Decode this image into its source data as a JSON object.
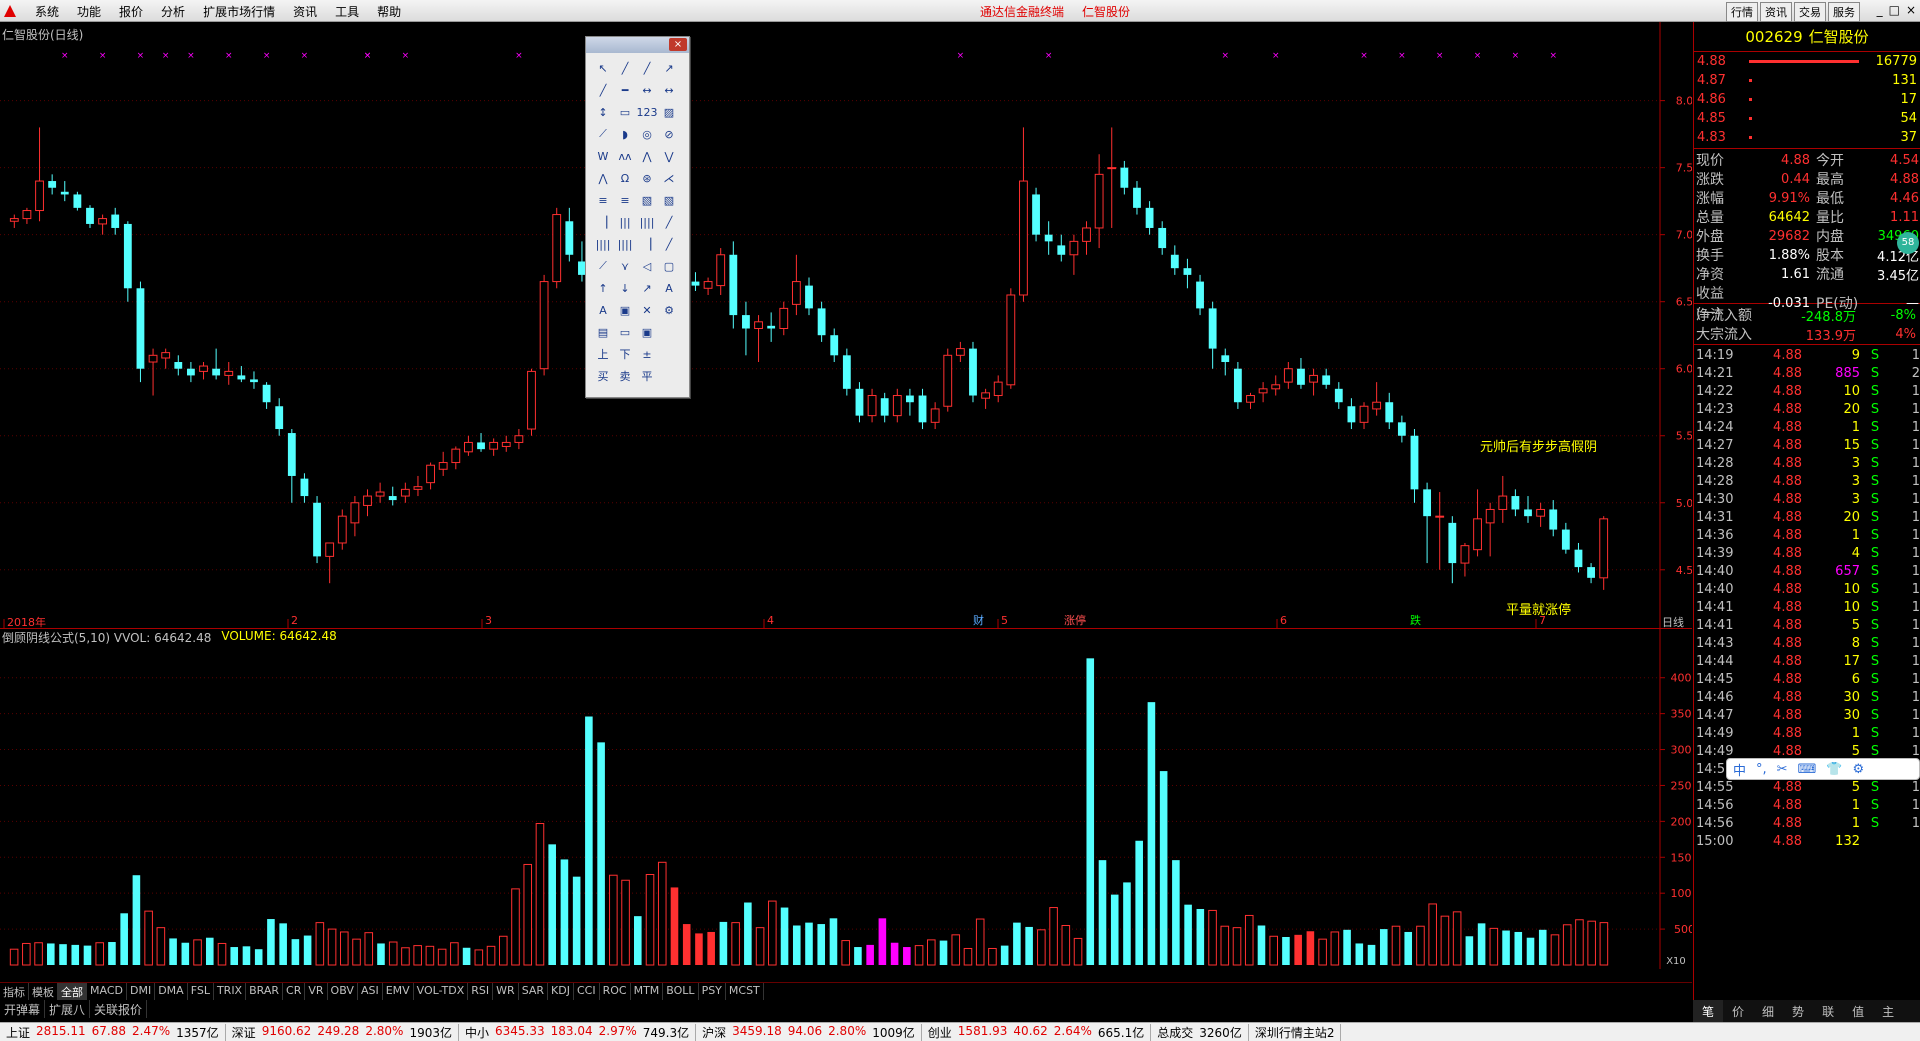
{
  "menubar": {
    "items": [
      "系统",
      "功能",
      "报价",
      "分析",
      "扩展市场行情",
      "资讯",
      "工具",
      "帮助"
    ],
    "center_title": "通达信金融终端",
    "center_stock": "仁智股份",
    "right_buttons": [
      "行情",
      "资讯",
      "交易",
      "服务"
    ],
    "win_controls": [
      "_",
      "□",
      "×"
    ]
  },
  "main_chart": {
    "title": "仁智股份(日线)",
    "annotation_1": "元帅后有步步高假阴",
    "annotation_2": "平量就涨停",
    "markers": [
      {
        "text": "财",
        "color": "#5aaaff"
      },
      {
        "text": "涨停",
        "color": "#ff5050"
      },
      {
        "text": "跌",
        "color": "#00ff00"
      }
    ],
    "y_ticks": [
      "8.00",
      "7.50",
      "7.00",
      "6.50",
      "6.00",
      "5.50",
      "5.00",
      "4.50"
    ],
    "x_labels": [
      "2018年",
      "2",
      "3",
      "4",
      "5",
      "6",
      "7"
    ],
    "period_label": "日线"
  },
  "vol_chart": {
    "title": "倒顾阴线公式(5,10)  VVOL: 64642.48",
    "volume_label": "VOLUME: 64642.48",
    "y_ticks": [
      "40000",
      "35000",
      "30000",
      "25000",
      "20000",
      "15000",
      "10000",
      "5000"
    ],
    "scale_label": "X10"
  },
  "chart_data": {
    "type": "candlestick",
    "ylim": [
      4.2,
      8.4
    ],
    "candles": [
      [
        7.1,
        7.15,
        7.05,
        7.12
      ],
      [
        7.12,
        7.2,
        7.08,
        7.18
      ],
      [
        7.18,
        7.8,
        7.1,
        7.4
      ],
      [
        7.4,
        7.45,
        7.3,
        7.35
      ],
      [
        7.32,
        7.4,
        7.25,
        7.3
      ],
      [
        7.3,
        7.32,
        7.18,
        7.2
      ],
      [
        7.2,
        7.22,
        7.05,
        7.08
      ],
      [
        7.08,
        7.15,
        7.0,
        7.12
      ],
      [
        7.15,
        7.2,
        7.0,
        7.05
      ],
      [
        7.08,
        7.1,
        6.5,
        6.6
      ],
      [
        6.6,
        6.65,
        5.9,
        6.0
      ],
      [
        6.05,
        6.15,
        5.8,
        6.1
      ],
      [
        6.08,
        6.15,
        6.0,
        6.12
      ],
      [
        6.05,
        6.1,
        5.95,
        6.0
      ],
      [
        6.0,
        6.05,
        5.9,
        5.95
      ],
      [
        5.98,
        6.05,
        5.92,
        6.02
      ],
      [
        6.0,
        6.15,
        5.92,
        5.95
      ],
      [
        5.95,
        6.05,
        5.88,
        5.98
      ],
      [
        5.95,
        6.02,
        5.9,
        5.92
      ],
      [
        5.92,
        5.98,
        5.85,
        5.9
      ],
      [
        5.88,
        5.9,
        5.7,
        5.75
      ],
      [
        5.72,
        5.78,
        5.5,
        5.55
      ],
      [
        5.52,
        5.55,
        5.0,
        5.2
      ],
      [
        5.18,
        5.22,
        5.0,
        5.05
      ],
      [
        5.0,
        5.05,
        4.55,
        4.6
      ],
      [
        4.6,
        4.7,
        4.4,
        4.7
      ],
      [
        4.7,
        4.95,
        4.65,
        4.9
      ],
      [
        4.85,
        5.05,
        4.75,
        5.0
      ],
      [
        4.98,
        5.1,
        4.9,
        5.05
      ],
      [
        5.05,
        5.15,
        5.0,
        5.08
      ],
      [
        5.05,
        5.12,
        4.98,
        5.02
      ],
      [
        5.05,
        5.15,
        5.0,
        5.1
      ],
      [
        5.1,
        5.2,
        5.05,
        5.12
      ],
      [
        5.15,
        5.3,
        5.1,
        5.28
      ],
      [
        5.25,
        5.38,
        5.2,
        5.3
      ],
      [
        5.3,
        5.42,
        5.25,
        5.4
      ],
      [
        5.38,
        5.5,
        5.35,
        5.45
      ],
      [
        5.45,
        5.52,
        5.38,
        5.4
      ],
      [
        5.4,
        5.48,
        5.35,
        5.45
      ],
      [
        5.42,
        5.5,
        5.38,
        5.45
      ],
      [
        5.45,
        5.55,
        5.4,
        5.5
      ],
      [
        5.55,
        6.0,
        5.5,
        5.98
      ],
      [
        6.0,
        6.7,
        5.95,
        6.65
      ],
      [
        6.65,
        7.2,
        6.6,
        7.15
      ],
      [
        7.1,
        7.2,
        6.8,
        6.85
      ],
      [
        6.8,
        6.95,
        6.65,
        6.7
      ],
      [
        6.72,
        6.8,
        6.55,
        6.6
      ],
      [
        6.58,
        6.65,
        6.5,
        6.55
      ],
      [
        6.55,
        6.62,
        6.45,
        6.5
      ],
      [
        6.5,
        6.6,
        6.45,
        6.52
      ],
      [
        6.52,
        6.7,
        6.48,
        6.65
      ],
      [
        6.62,
        6.7,
        6.55,
        6.58
      ],
      [
        6.58,
        6.65,
        6.52,
        6.6
      ],
      [
        6.62,
        6.7,
        6.55,
        6.65
      ],
      [
        6.65,
        6.72,
        6.58,
        6.62
      ],
      [
        6.6,
        6.68,
        6.55,
        6.65
      ],
      [
        6.62,
        6.9,
        6.55,
        6.85
      ],
      [
        6.85,
        6.95,
        6.3,
        6.4
      ],
      [
        6.4,
        6.5,
        6.1,
        6.3
      ],
      [
        6.3,
        6.4,
        6.05,
        6.35
      ],
      [
        6.32,
        6.42,
        6.2,
        6.3
      ],
      [
        6.3,
        6.5,
        6.25,
        6.45
      ],
      [
        6.48,
        6.85,
        6.4,
        6.65
      ],
      [
        6.62,
        6.68,
        6.4,
        6.45
      ],
      [
        6.45,
        6.5,
        6.2,
        6.25
      ],
      [
        6.25,
        6.3,
        6.05,
        6.1
      ],
      [
        6.1,
        6.15,
        5.8,
        5.85
      ],
      [
        5.85,
        5.9,
        5.6,
        5.65
      ],
      [
        5.65,
        5.85,
        5.6,
        5.8
      ],
      [
        5.78,
        5.82,
        5.6,
        5.65
      ],
      [
        5.65,
        5.85,
        5.6,
        5.8
      ],
      [
        5.8,
        5.85,
        5.65,
        5.75
      ],
      [
        5.8,
        5.85,
        5.55,
        5.6
      ],
      [
        5.6,
        5.75,
        5.55,
        5.7
      ],
      [
        5.72,
        6.15,
        5.68,
        6.1
      ],
      [
        6.1,
        6.2,
        6.05,
        6.15
      ],
      [
        6.15,
        6.2,
        5.75,
        5.8
      ],
      [
        5.78,
        5.85,
        5.7,
        5.82
      ],
      [
        5.8,
        5.95,
        5.75,
        5.9
      ],
      [
        5.88,
        6.6,
        5.85,
        6.55
      ],
      [
        6.55,
        7.8,
        6.5,
        7.4
      ],
      [
        7.3,
        7.35,
        6.95,
        7.0
      ],
      [
        7.0,
        7.1,
        6.85,
        6.95
      ],
      [
        6.92,
        7.0,
        6.8,
        6.85
      ],
      [
        6.85,
        7.0,
        6.7,
        6.95
      ],
      [
        6.95,
        7.1,
        6.85,
        7.05
      ],
      [
        7.05,
        7.6,
        6.9,
        7.45
      ],
      [
        7.5,
        7.8,
        7.05,
        7.5
      ],
      [
        7.5,
        7.55,
        7.3,
        7.35
      ],
      [
        7.35,
        7.4,
        7.15,
        7.2
      ],
      [
        7.2,
        7.25,
        7.0,
        7.05
      ],
      [
        7.05,
        7.1,
        6.85,
        6.9
      ],
      [
        6.85,
        6.92,
        6.7,
        6.75
      ],
      [
        6.75,
        6.82,
        6.6,
        6.7
      ],
      [
        6.65,
        6.7,
        6.4,
        6.45
      ],
      [
        6.45,
        6.5,
        6.0,
        6.15
      ],
      [
        6.1,
        6.15,
        5.95,
        6.05
      ],
      [
        6.0,
        6.05,
        5.7,
        5.75
      ],
      [
        5.75,
        5.82,
        5.7,
        5.8
      ],
      [
        5.82,
        5.9,
        5.75,
        5.85
      ],
      [
        5.85,
        5.95,
        5.8,
        5.88
      ],
      [
        5.9,
        6.05,
        5.85,
        6.0
      ],
      [
        6.0,
        6.08,
        5.85,
        5.88
      ],
      [
        5.9,
        6.0,
        5.8,
        5.95
      ],
      [
        5.95,
        6.0,
        5.85,
        5.88
      ],
      [
        5.85,
        5.9,
        5.7,
        5.75
      ],
      [
        5.72,
        5.78,
        5.55,
        5.6
      ],
      [
        5.6,
        5.75,
        5.55,
        5.72
      ],
      [
        5.7,
        5.9,
        5.65,
        5.75
      ],
      [
        5.75,
        5.82,
        5.55,
        5.6
      ],
      [
        5.6,
        5.65,
        5.45,
        5.5
      ],
      [
        5.5,
        5.55,
        5.0,
        5.1
      ],
      [
        5.1,
        5.15,
        4.55,
        4.9
      ],
      [
        4.9,
        5.08,
        4.5,
        4.9
      ],
      [
        4.85,
        4.9,
        4.4,
        4.55
      ],
      [
        4.55,
        4.7,
        4.45,
        4.68
      ],
      [
        4.65,
        5.1,
        4.6,
        4.88
      ],
      [
        4.85,
        5.0,
        4.6,
        4.95
      ],
      [
        4.95,
        5.2,
        4.85,
        5.05
      ],
      [
        5.05,
        5.1,
        4.9,
        4.95
      ],
      [
        4.95,
        5.05,
        4.85,
        4.9
      ],
      [
        4.9,
        5.0,
        4.82,
        4.95
      ],
      [
        4.95,
        5.02,
        4.75,
        4.8
      ],
      [
        4.8,
        4.85,
        4.62,
        4.65
      ],
      [
        4.65,
        4.7,
        4.48,
        4.52
      ],
      [
        4.52,
        4.55,
        4.4,
        4.44
      ],
      [
        4.44,
        4.9,
        4.35,
        4.88
      ]
    ],
    "volumes": [
      2200,
      3000,
      3100,
      3000,
      2900,
      2800,
      2700,
      3100,
      3200,
      7200,
      12500,
      7500,
      5200,
      3700,
      3100,
      3500,
      3800,
      3000,
      2500,
      2600,
      2200,
      6400,
      5800,
      3600,
      4100,
      5900,
      5000,
      4600,
      3600,
      4500,
      3000,
      3200,
      2400,
      2700,
      2600,
      2200,
      3100,
      2400,
      2100,
      2600,
      4000,
      10600,
      14000,
      19700,
      16800,
      14700,
      12300,
      34600,
      31000,
      12500,
      11800,
      6800,
      12600,
      14300,
      10800,
      5700,
      4400,
      4600,
      6000,
      5900,
      8700,
      5200,
      8900,
      8000,
      5500,
      5900,
      5700,
      6500,
      3400,
      2500,
      2800,
      6500,
      3100,
      2500,
      2700,
      3500,
      3400,
      4200,
      2300,
      6400,
      2300,
      2700,
      5900,
      5300,
      4900,
      8000,
      5500,
      3700,
      42700,
      14600,
      9800,
      11500,
      17300,
      36600,
      27000,
      14600,
      8400,
      7800,
      7600,
      5400,
      5200,
      6900,
      5500,
      4000,
      3900,
      4200,
      4700,
      3600,
      4600,
      4900,
      3000,
      2800,
      5000,
      5400,
      4600,
      5400,
      8500,
      6800,
      7400,
      4000,
      5800,
      5100,
      4800,
      4600,
      3800,
      4900,
      4200,
      5600,
      6300,
      6100,
      5900
    ],
    "volume_colors": {
      "up": "#ff3030",
      "down": "#54ffff",
      "special": "#ff00ff"
    }
  },
  "toolbox": {
    "close": "×",
    "tools": [
      "↖",
      "╱",
      "╱",
      "↗",
      "╱",
      "━",
      "↔",
      "↔",
      "↕",
      "▭",
      "123",
      "▨",
      "⟋",
      "◗",
      "◎",
      "⊘",
      "W",
      "ʌʌ",
      "⋀",
      "⋁",
      "⋀",
      "Ω",
      "⊛",
      "⋌",
      "≡",
      "≡",
      "▧",
      "▧",
      "▕",
      "|||",
      "||||",
      "╱",
      "||||",
      "||||",
      "▕",
      "╱",
      "⟋",
      "⋎",
      "◁",
      "▢",
      "↑",
      "↓",
      "↗",
      "A",
      "A",
      "▣",
      "✕",
      "⚙",
      "▤",
      "▭",
      "▣",
      " ",
      "上",
      "下",
      "±",
      " ",
      "买",
      "卖",
      "平"
    ]
  },
  "right_panel": {
    "stock_code": "002629",
    "stock_name": "仁智股份",
    "orders": [
      {
        "price": "4.88",
        "bar": 1.0,
        "qty": "16779"
      },
      {
        "price": "4.87",
        "bar": 0.02,
        "qty": "131"
      },
      {
        "price": "4.86",
        "bar": 0.02,
        "qty": "17"
      },
      {
        "price": "4.85",
        "bar": 0.02,
        "qty": "54"
      },
      {
        "price": "4.83",
        "bar": 0.02,
        "qty": "37"
      }
    ],
    "badge": "58",
    "quotes": [
      {
        "k1": "现价",
        "v1": "4.88",
        "c1": "red",
        "k2": "今开",
        "v2": "4.54",
        "c2": "red"
      },
      {
        "k1": "涨跌",
        "v1": "0.44",
        "c1": "red",
        "k2": "最高",
        "v2": "4.88",
        "c2": "red"
      },
      {
        "k1": "涨幅",
        "v1": "9.91%",
        "c1": "red",
        "k2": "最低",
        "v2": "4.46",
        "c2": "red"
      },
      {
        "k1": "总量",
        "v1": "64642",
        "c1": "yellow",
        "k2": "量比",
        "v2": "1.11",
        "c2": "red"
      },
      {
        "k1": "外盘",
        "v1": "29682",
        "c1": "red",
        "k2": "内盘",
        "v2": "34960",
        "c2": "green"
      },
      {
        "k1": "换手",
        "v1": "1.88%",
        "c1": "white",
        "k2": "股本",
        "v2": "4.12亿",
        "c2": "white"
      },
      {
        "k1": "净资",
        "v1": "1.61",
        "c1": "white",
        "k2": "流通",
        "v2": "3.45亿",
        "c2": "white"
      },
      {
        "k1": "收益(一)",
        "v1": "-0.031",
        "c1": "white",
        "k2": "PE(动)",
        "v2": "—",
        "c2": "white"
      }
    ],
    "flows": [
      {
        "k": "净流入额",
        "v": "-248.8万",
        "p": "-8%",
        "c": "green"
      },
      {
        "k": "大宗流入",
        "v": "133.9万",
        "p": "4%",
        "c": "red"
      }
    ],
    "ticks": [
      {
        "t": "14:19",
        "p": "4.88",
        "v": "9",
        "s": "S",
        "n": "1",
        "vc": "yellow"
      },
      {
        "t": "14:21",
        "p": "4.88",
        "v": "885",
        "s": "S",
        "n": "2",
        "vc": "magenta"
      },
      {
        "t": "14:22",
        "p": "4.88",
        "v": "10",
        "s": "S",
        "n": "1",
        "vc": "yellow"
      },
      {
        "t": "14:23",
        "p": "4.88",
        "v": "20",
        "s": "S",
        "n": "1",
        "vc": "yellow"
      },
      {
        "t": "14:24",
        "p": "4.88",
        "v": "1",
        "s": "S",
        "n": "1",
        "vc": "yellow"
      },
      {
        "t": "14:27",
        "p": "4.88",
        "v": "15",
        "s": "S",
        "n": "1",
        "vc": "yellow"
      },
      {
        "t": "14:28",
        "p": "4.88",
        "v": "3",
        "s": "S",
        "n": "1",
        "vc": "yellow"
      },
      {
        "t": "14:28",
        "p": "4.88",
        "v": "3",
        "s": "S",
        "n": "1",
        "vc": "yellow"
      },
      {
        "t": "14:30",
        "p": "4.88",
        "v": "3",
        "s": "S",
        "n": "1",
        "vc": "yellow"
      },
      {
        "t": "14:31",
        "p": "4.88",
        "v": "20",
        "s": "S",
        "n": "1",
        "vc": "yellow"
      },
      {
        "t": "14:36",
        "p": "4.88",
        "v": "1",
        "s": "S",
        "n": "1",
        "vc": "yellow"
      },
      {
        "t": "14:39",
        "p": "4.88",
        "v": "4",
        "s": "S",
        "n": "1",
        "vc": "yellow"
      },
      {
        "t": "14:40",
        "p": "4.88",
        "v": "657",
        "s": "S",
        "n": "1",
        "vc": "magenta"
      },
      {
        "t": "14:40",
        "p": "4.88",
        "v": "10",
        "s": "S",
        "n": "1",
        "vc": "yellow"
      },
      {
        "t": "14:41",
        "p": "4.88",
        "v": "10",
        "s": "S",
        "n": "1",
        "vc": "yellow"
      },
      {
        "t": "14:41",
        "p": "4.88",
        "v": "5",
        "s": "S",
        "n": "1",
        "vc": "yellow"
      },
      {
        "t": "14:43",
        "p": "4.88",
        "v": "8",
        "s": "S",
        "n": "1",
        "vc": "yellow"
      },
      {
        "t": "14:44",
        "p": "4.88",
        "v": "17",
        "s": "S",
        "n": "1",
        "vc": "yellow"
      },
      {
        "t": "14:45",
        "p": "4.88",
        "v": "6",
        "s": "S",
        "n": "1",
        "vc": "yellow"
      },
      {
        "t": "14:46",
        "p": "4.88",
        "v": "30",
        "s": "S",
        "n": "1",
        "vc": "yellow"
      },
      {
        "t": "14:47",
        "p": "4.88",
        "v": "30",
        "s": "S",
        "n": "1",
        "vc": "yellow"
      },
      {
        "t": "14:49",
        "p": "4.88",
        "v": "1",
        "s": "S",
        "n": "1",
        "vc": "yellow"
      },
      {
        "t": "14:49",
        "p": "4.88",
        "v": "5",
        "s": "S",
        "n": "1",
        "vc": "yellow"
      },
      {
        "t": "14:52",
        "p": "4.88",
        "v": "35",
        "s": "S",
        "n": "1",
        "vc": "yellow"
      },
      {
        "t": "14:55",
        "p": "4.88",
        "v": "5",
        "s": "S",
        "n": "1",
        "vc": "yellow"
      },
      {
        "t": "14:56",
        "p": "4.88",
        "v": "1",
        "s": "S",
        "n": "1",
        "vc": "yellow"
      },
      {
        "t": "14:56",
        "p": "4.88",
        "v": "1",
        "s": "S",
        "n": "1",
        "vc": "yellow"
      },
      {
        "t": "15:00",
        "p": "4.88",
        "v": "132",
        "s": "",
        "n": "",
        "vc": "yellow"
      }
    ],
    "tabs": [
      "笔",
      "价",
      "细",
      "势",
      "联",
      "值",
      "主"
    ]
  },
  "ime_bar": {
    "items": [
      "中",
      "°,",
      "✂",
      "⌨",
      "👕",
      "⚙"
    ]
  },
  "tabbar1": [
    "指标",
    "模板",
    "全部",
    "MACD",
    "DMI",
    "DMA",
    "FSL",
    "TRIX",
    "BRAR",
    "CR",
    "VR",
    "OBV",
    "ASI",
    "EMV",
    "VOL-TDX",
    "RSI",
    "WR",
    "SAR",
    "KDJ",
    "CCI",
    "ROC",
    "MTM",
    "BOLL",
    "PSY",
    "MCST"
  ],
  "tabbar2": [
    "开弹幕",
    "扩展八",
    "关联报价"
  ],
  "statusbar": [
    {
      "name": "上证",
      "val": "2815.11",
      "chg": "67.88",
      "pct": "2.47%",
      "amt": "1357亿"
    },
    {
      "name": "深证",
      "val": "9160.62",
      "chg": "249.28",
      "pct": "2.80%",
      "amt": "1903亿"
    },
    {
      "name": "中小",
      "val": "6345.33",
      "chg": "183.04",
      "pct": "2.97%",
      "amt": "749.3亿"
    },
    {
      "name": "沪深",
      "val": "3459.18",
      "chg": "94.06",
      "pct": "2.80%",
      "amt": "1009亿"
    },
    {
      "name": "创业",
      "val": "1581.93",
      "chg": "40.62",
      "pct": "2.64%",
      "amt": "665.1亿"
    }
  ],
  "status_extra": {
    "total_label": "总成交",
    "total": "3260亿",
    "feed": "深圳行情主站2"
  }
}
